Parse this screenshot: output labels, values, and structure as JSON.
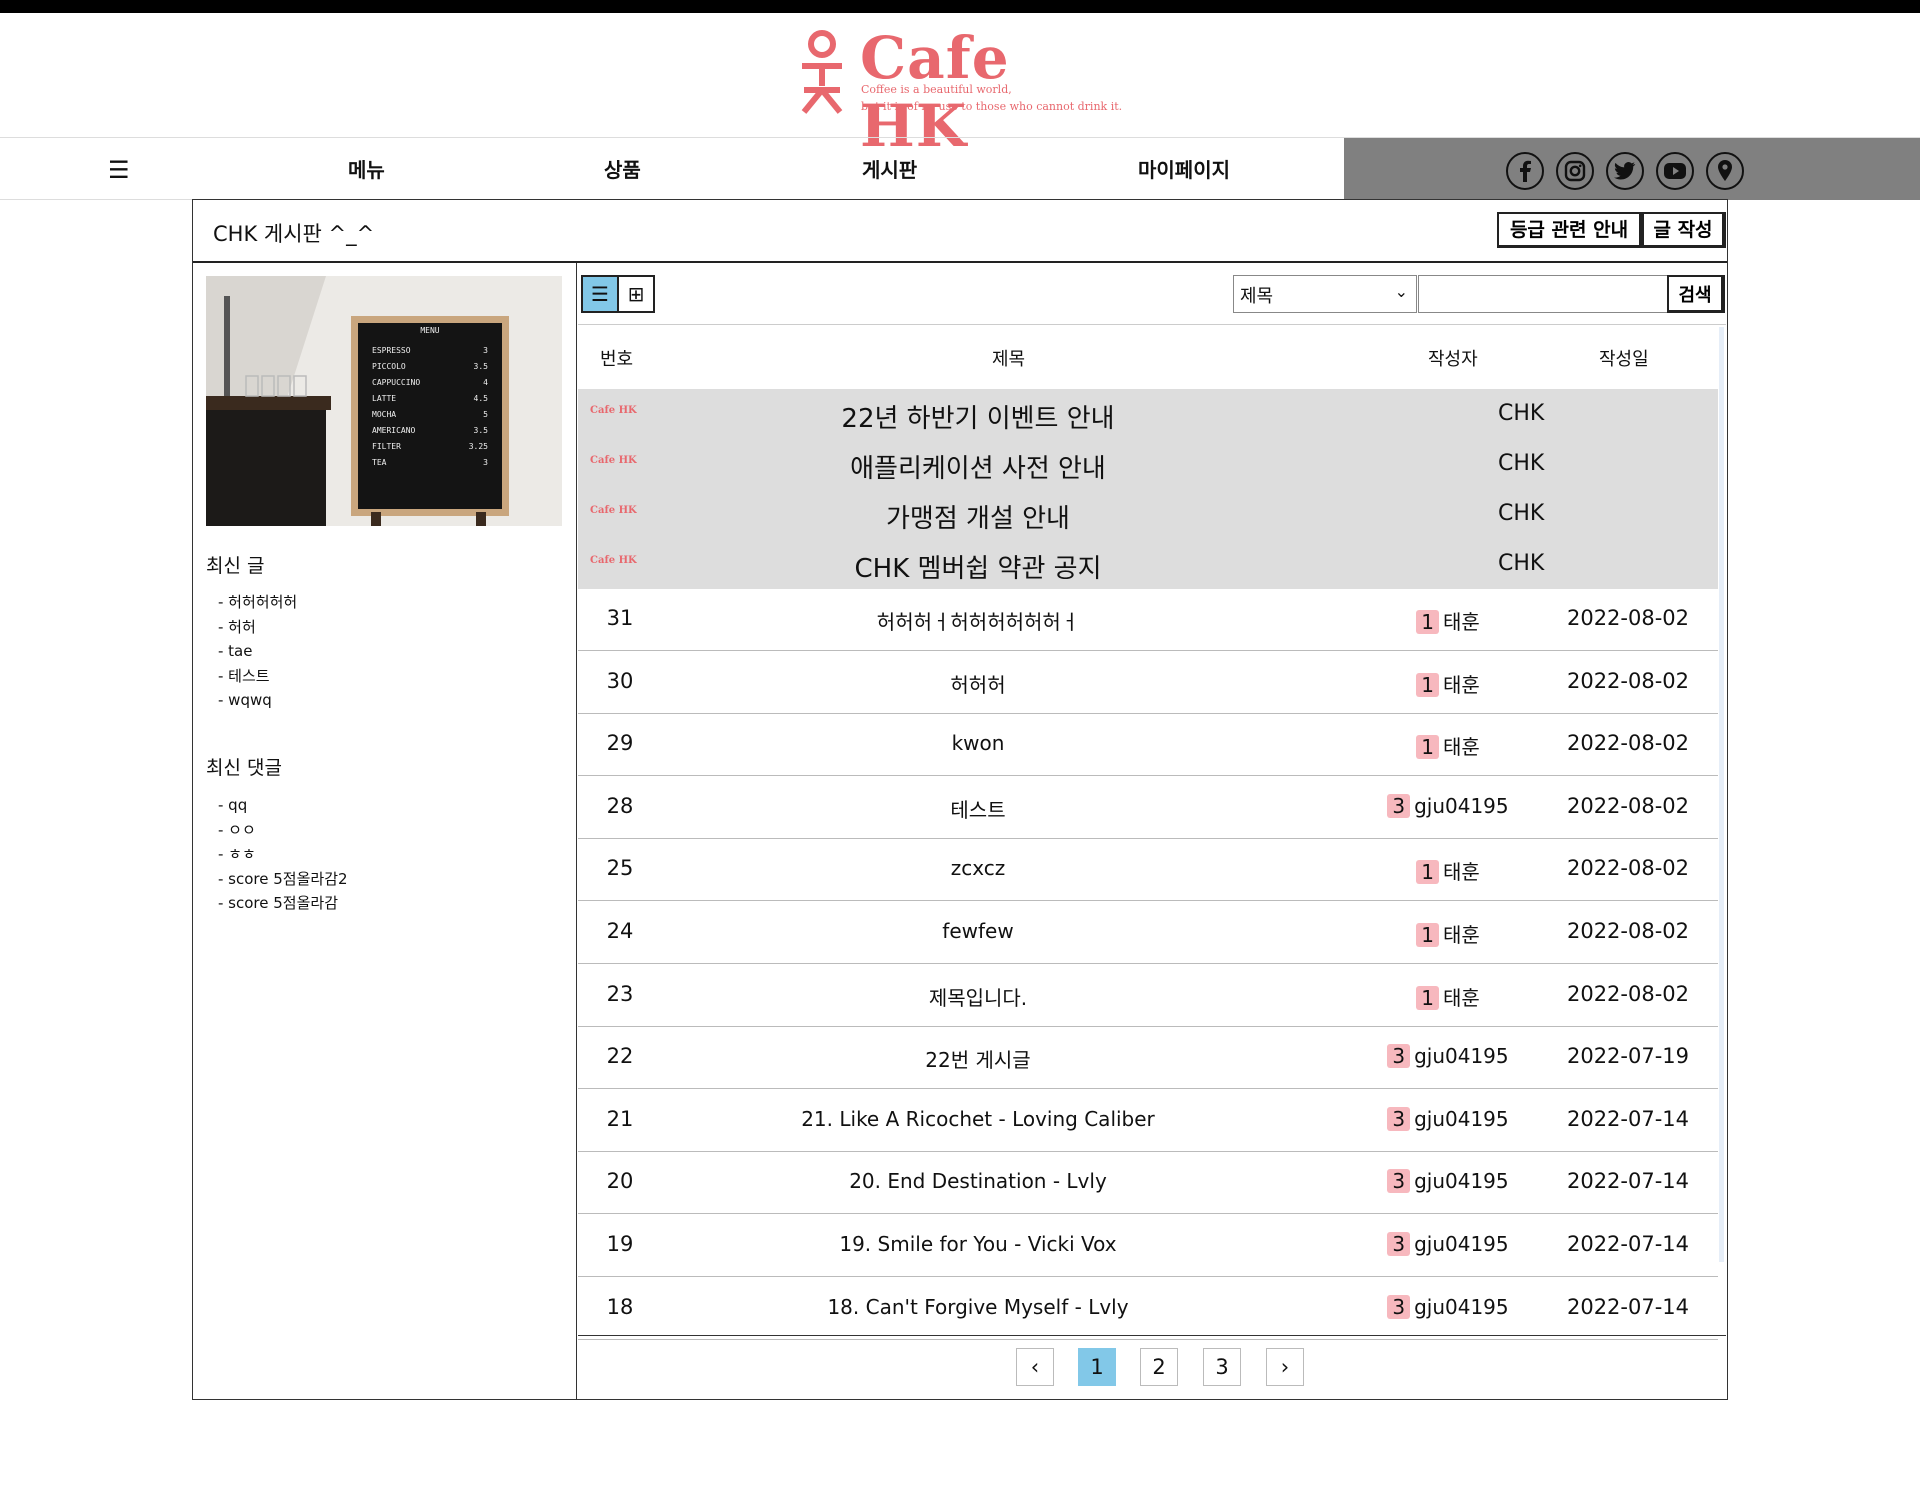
{
  "brand": {
    "name": "Cafe HK",
    "tagline_line1": "Coffee is a beautiful world,",
    "tagline_line2": "but it is of no use to those who cannot drink it."
  },
  "nav": {
    "menu_icon": "hamburger-icon",
    "items": [
      "메뉴",
      "상품",
      "게시판",
      "마이페이지"
    ],
    "social": [
      "facebook-icon",
      "instagram-icon",
      "twitter-icon",
      "youtube-icon",
      "location-icon"
    ]
  },
  "board": {
    "title": "CHK 게시판 ^_^",
    "grade_info_button": "등급 관련 안내",
    "write_button": "글 작성"
  },
  "sidebar": {
    "image_alt": "cafe menu board",
    "menu_board": {
      "heading": "MENU",
      "items": [
        [
          "ESPRESSO",
          "3"
        ],
        [
          "PICCOLO",
          "3.5"
        ],
        [
          "CAPPUCCINO",
          "4"
        ],
        [
          "LATTE",
          "4.5"
        ],
        [
          "MOCHA",
          "5"
        ],
        [
          "AMERICANO",
          "3.5"
        ],
        [
          "FILTER",
          "3.25"
        ],
        [
          "TEA",
          "3"
        ]
      ]
    },
    "recent_posts_title": "최신 글",
    "recent_posts": [
      "- 허허허허허",
      "- 허허",
      "- tae",
      "- 테스트",
      "- wqwq"
    ],
    "recent_comments_title": "최신 댓글",
    "recent_comments": [
      "- qq",
      "- ㅇㅇ",
      "- ㅎㅎ",
      "- score 5점올라감2",
      "- score 5점올라감"
    ]
  },
  "toolbar": {
    "list_view_icon": "list-icon",
    "grid_view_icon": "grid-icon",
    "search_field_selected": "제목",
    "search_placeholder": "",
    "search_button": "검색"
  },
  "table": {
    "headers": {
      "no": "번호",
      "title": "제목",
      "author": "작성자",
      "date": "작성일"
    },
    "notices": [
      {
        "badge": "Cafe HK",
        "title": "22년 하반기 이벤트 안내",
        "author": "CHK"
      },
      {
        "badge": "Cafe HK",
        "title": "애플리케이션 사전 안내",
        "author": "CHK"
      },
      {
        "badge": "Cafe HK",
        "title": "가맹점 개설 안내",
        "author": "CHK"
      },
      {
        "badge": "Cafe HK",
        "title": "CHK 멤버쉽 약관 공지",
        "author": "CHK"
      }
    ],
    "rows": [
      {
        "no": "31",
        "title": "허허허ㅓ허허허허허허ㅓ",
        "grade": "1",
        "author": "태훈",
        "date": "2022-08-02"
      },
      {
        "no": "30",
        "title": "허허허",
        "grade": "1",
        "author": "태훈",
        "date": "2022-08-02"
      },
      {
        "no": "29",
        "title": "kwon",
        "grade": "1",
        "author": "태훈",
        "date": "2022-08-02"
      },
      {
        "no": "28",
        "title": "테스트",
        "grade": "3",
        "author": "gju04195",
        "date": "2022-08-02"
      },
      {
        "no": "25",
        "title": "zcxcz",
        "grade": "1",
        "author": "태훈",
        "date": "2022-08-02"
      },
      {
        "no": "24",
        "title": "fewfew",
        "grade": "1",
        "author": "태훈",
        "date": "2022-08-02"
      },
      {
        "no": "23",
        "title": "제목입니다.",
        "grade": "1",
        "author": "태훈",
        "date": "2022-08-02"
      },
      {
        "no": "22",
        "title": "22번 게시글",
        "grade": "3",
        "author": "gju04195",
        "date": "2022-07-19"
      },
      {
        "no": "21",
        "title": "21. Like A Ricochet - Loving Caliber",
        "grade": "3",
        "author": "gju04195",
        "date": "2022-07-14"
      },
      {
        "no": "20",
        "title": "20. End Destination - Lvly",
        "grade": "3",
        "author": "gju04195",
        "date": "2022-07-14"
      },
      {
        "no": "19",
        "title": "19. Smile for You - Vicki Vox",
        "grade": "3",
        "author": "gju04195",
        "date": "2022-07-14"
      },
      {
        "no": "18",
        "title": "18. Can't Forgive Myself - Lvly",
        "grade": "3",
        "author": "gju04195",
        "date": "2022-07-14"
      }
    ]
  },
  "pagination": {
    "prev": "‹",
    "pages": [
      "1",
      "2",
      "3"
    ],
    "current": "1",
    "next": "›"
  },
  "colors": {
    "brand": "#e8686e",
    "active_page": "#82c8e8",
    "grade_badge": "#f7b8be",
    "notice_bg": "#dddddd"
  }
}
